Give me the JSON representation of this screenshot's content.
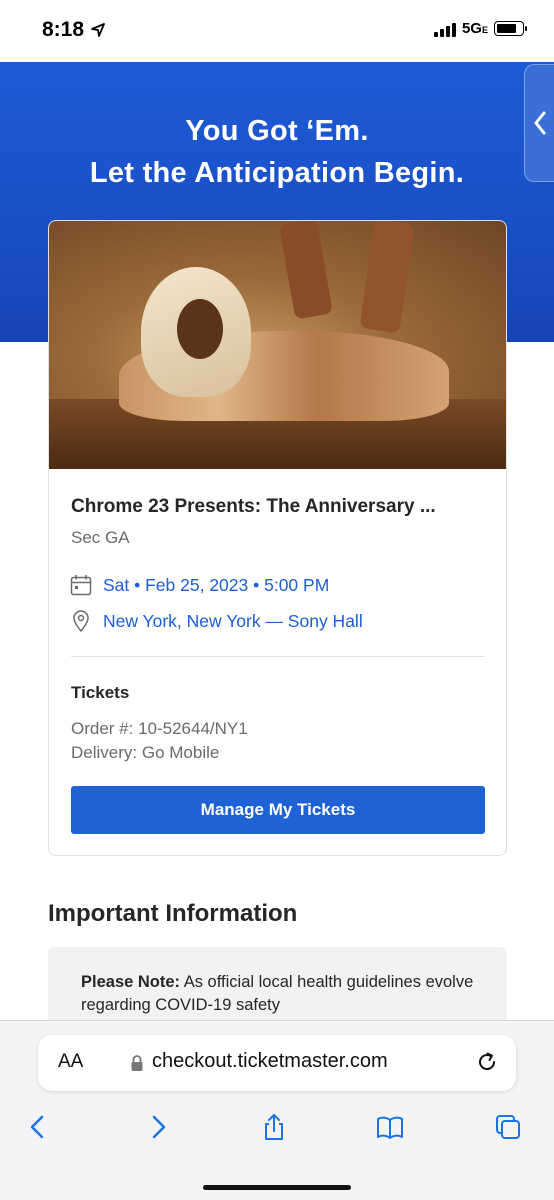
{
  "status_bar": {
    "time": "8:18",
    "network": "5G",
    "network_suffix": "E"
  },
  "hero": {
    "title_line1": "You Got ‘Em.",
    "title_line2": "Let the Anticipation Begin."
  },
  "event": {
    "title": "Chrome 23 Presents: The Anniversary ...",
    "section": "Sec GA",
    "date": "Sat • Feb 25, 2023 • 5:00 PM",
    "venue": "New York, New York — Sony Hall",
    "tickets_label": "Tickets",
    "order": "Order #: 10-52644/NY1",
    "delivery": "Delivery: Go Mobile",
    "manage_button": "Manage My Tickets"
  },
  "important": {
    "title": "Important Information",
    "note_label": "Please Note:",
    "note_text": " As official local health guidelines evolve regarding COVID-19 safety"
  },
  "browser": {
    "text_size_label": "AA",
    "url": "checkout.ticketmaster.com"
  },
  "colors": {
    "brand_blue": "#1f62d6",
    "link_blue": "#1c5fd6"
  },
  "icons": [
    "location-arrow-icon",
    "calendar-icon",
    "map-pin-icon",
    "lock-icon",
    "reload-icon",
    "back-icon",
    "forward-icon",
    "share-icon",
    "bookmarks-icon",
    "tabs-icon"
  ]
}
